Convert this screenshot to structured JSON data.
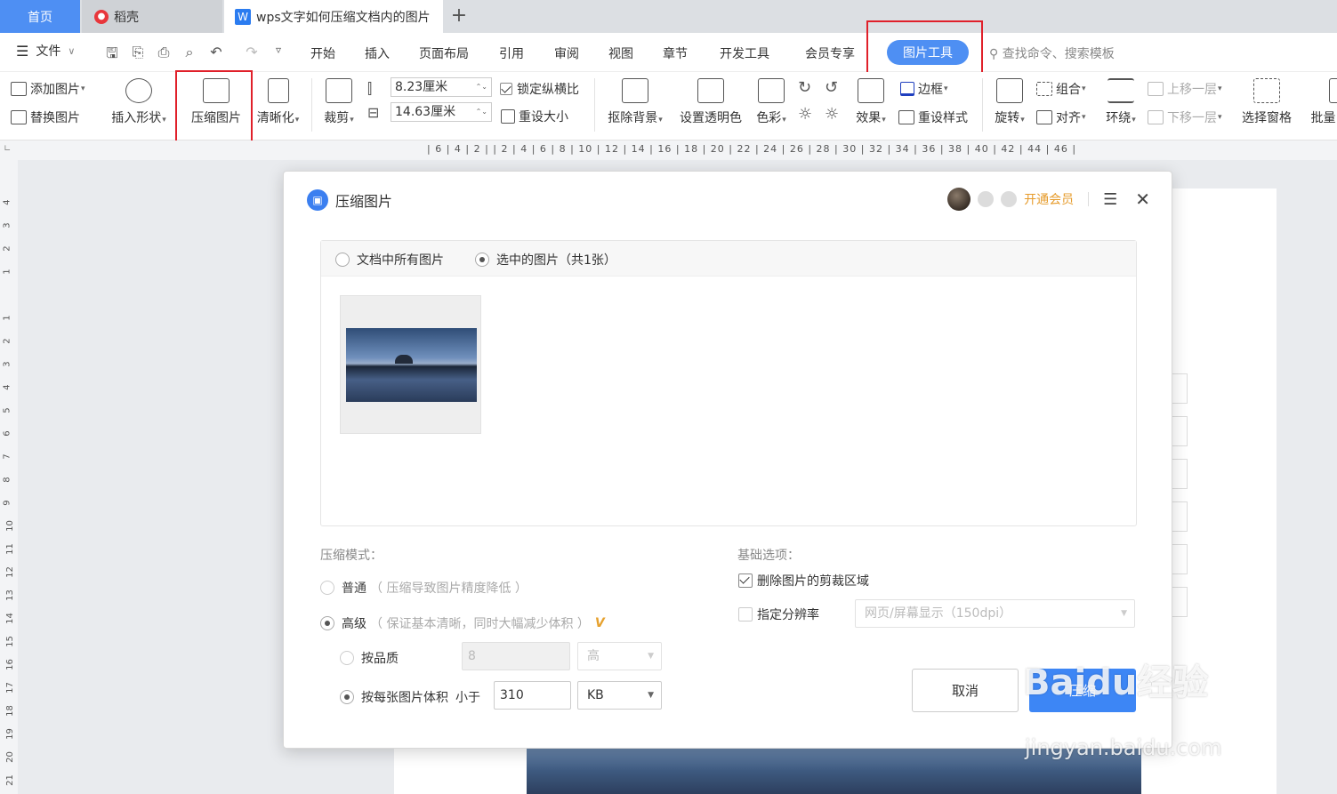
{
  "tabs": {
    "home": "首页",
    "daoke": "稻壳",
    "doc": "wps文字如何压缩文档内的图片",
    "plus": "+"
  },
  "menu": {
    "file": "文件",
    "items": [
      "开始",
      "插入",
      "页面布局",
      "引用",
      "审阅",
      "视图",
      "章节",
      "开发工具",
      "会员专享"
    ],
    "active": "图片工具",
    "search_placeholder": "查找命令、搜索模板"
  },
  "ribbon": {
    "add_image": "添加图片",
    "replace_image": "替换图片",
    "insert_shape": "插入形状",
    "compress_image": "压缩图片",
    "sharpen": "清晰化",
    "crop": "裁剪",
    "width": "8.23厘米",
    "height": "14.63厘米",
    "lock_ratio": "锁定纵横比",
    "reset_size": "重设大小",
    "remove_bg": "抠除背景",
    "set_transparent": "设置透明色",
    "color": "色彩",
    "effect": "效果",
    "border": "边框",
    "reset_style": "重设样式",
    "rotate": "旋转",
    "group": "组合",
    "align": "对齐",
    "wrap": "环绕",
    "bring_forward": "上移一层",
    "send_backward": "下移一层",
    "selection_pane": "选择窗格",
    "batch": "批量"
  },
  "ruler": {
    "h": "| 6 | 4 | 2 |   | 2 | 4 | 6 | 8 | 10 | 12 | 14 | 16 | 18 | 20 | 22 | 24 | 26 | 28 | 30 | 32 | 34 | 36 | 38 | 40 | 42 | 44 | 46 |",
    "v": [
      "4",
      "3",
      "2",
      "1",
      "1",
      "2",
      "3",
      "4",
      "5",
      "6",
      "7",
      "8",
      "9",
      "10",
      "11",
      "12",
      "13",
      "14",
      "15",
      "16",
      "17",
      "18",
      "19",
      "20",
      "21"
    ]
  },
  "dialog": {
    "title": "压缩图片",
    "vip": "开通会员",
    "scope_all": "文档中所有图片",
    "scope_selected": "选中的图片（共1张）",
    "mode_label": "压缩模式：",
    "mode_normal": "普通",
    "mode_normal_desc": "（ 压缩导致图片精度降低 ）",
    "mode_advanced": "高级",
    "mode_advanced_desc": "（ 保证基本清晰，同时大幅减少体积 ）",
    "vip_mark": "V",
    "by_quality": "按品质",
    "quality_value": "8",
    "quality_level": "高",
    "by_size": "按每张图片体积",
    "less_than": "小于",
    "size_value": "310",
    "size_unit": "KB",
    "basic_label": "基础选项：",
    "delete_crop": "删除图片的剪裁区域",
    "set_resolution": "指定分辨率",
    "resolution_value": "网页/屏幕显示（150dpi）",
    "cancel": "取消",
    "compress": "压缩"
  },
  "watermark": {
    "brand": "Baidu经验",
    "url": "jingyan.baidu.com"
  },
  "colors": {
    "accent": "#3d86f5",
    "highlight_box": "#e0202a",
    "vip": "#e69b2b"
  }
}
